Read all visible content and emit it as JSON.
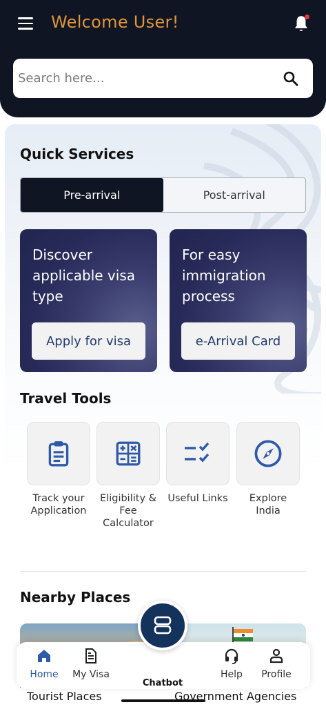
{
  "header": {
    "welcome_text": "Welcome User!",
    "search_placeholder": "Search here..."
  },
  "quick_services": {
    "title": "Quick Services",
    "tabs": [
      {
        "label": "Pre-arrival",
        "active": true
      },
      {
        "label": "Post-arrival",
        "active": false
      }
    ],
    "cards": [
      {
        "text": "Discover applicable visa type",
        "button": "Apply for visa"
      },
      {
        "text": "For easy immigration process",
        "button": "e-Arrival Card"
      }
    ]
  },
  "travel_tools": {
    "title": "Travel Tools",
    "items": [
      {
        "label": "Track your Application",
        "icon": "clipboard-icon"
      },
      {
        "label": "Eligibility & Fee Calculator",
        "icon": "calculator-icon"
      },
      {
        "label": "Useful Links",
        "icon": "checklist-icon"
      },
      {
        "label": "Explore India",
        "icon": "compass-icon"
      }
    ]
  },
  "nearby": {
    "title": "Nearby Places",
    "places": [
      {
        "label": "Tourist Places"
      },
      {
        "label": "Government Agencies"
      }
    ]
  },
  "bottom_nav": {
    "items": [
      {
        "label": "Home",
        "icon": "home-icon",
        "active": true
      },
      {
        "label": "My Visa",
        "icon": "document-icon",
        "active": false
      },
      {
        "label": "Chatbot",
        "icon": "robot-icon",
        "active": false
      },
      {
        "label": "Help",
        "icon": "headset-icon",
        "active": false
      },
      {
        "label": "Profile",
        "icon": "profile-icon",
        "active": false
      }
    ]
  },
  "colors": {
    "header_bg": "#0f1522",
    "accent_orange": "#e0963a",
    "icon_blue": "#2e5aa8",
    "notification_dot": "#e23b3b"
  }
}
